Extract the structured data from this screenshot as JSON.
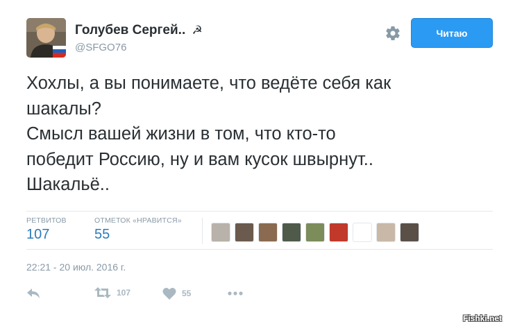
{
  "user": {
    "name": "Голубев Сергей..",
    "emblem": "☭",
    "handle": "@SFGO76"
  },
  "follow_button": {
    "label": "Читаю"
  },
  "tweet": {
    "lines": [
      "Хохлы, а вы понимаете, что ведёте себя как",
      "шакалы?",
      "Смысл вашей жизни в том, что кто-то",
      "победит Россию, ну и вам кусок швырнут..",
      "Шакальё.."
    ]
  },
  "stats": {
    "retweets_label": "РЕТВИТОВ",
    "retweets_value": "107",
    "likes_label": "ОТМЕТОК «НРАВИТСЯ»",
    "likes_value": "55"
  },
  "likers": [
    {
      "color": "#b8b2aa"
    },
    {
      "color": "#6b5a4e"
    },
    {
      "color": "#8a6a50"
    },
    {
      "color": "#4f5a4a"
    },
    {
      "color": "#7c8c5a"
    },
    {
      "color": "#c0392b"
    },
    {
      "color": "#ffffff"
    },
    {
      "color": "#c9b8a8"
    },
    {
      "color": "#5a5048"
    }
  ],
  "timestamp": "22:21 - 20 июл. 2016 г.",
  "actions": {
    "reply_icon": "reply-icon",
    "retweet_count": "107",
    "like_count": "55"
  },
  "watermark": "Fishki.net",
  "colors": {
    "accent": "#2b9af3",
    "link": "#2b7bb9",
    "muted": "#8899a6"
  }
}
